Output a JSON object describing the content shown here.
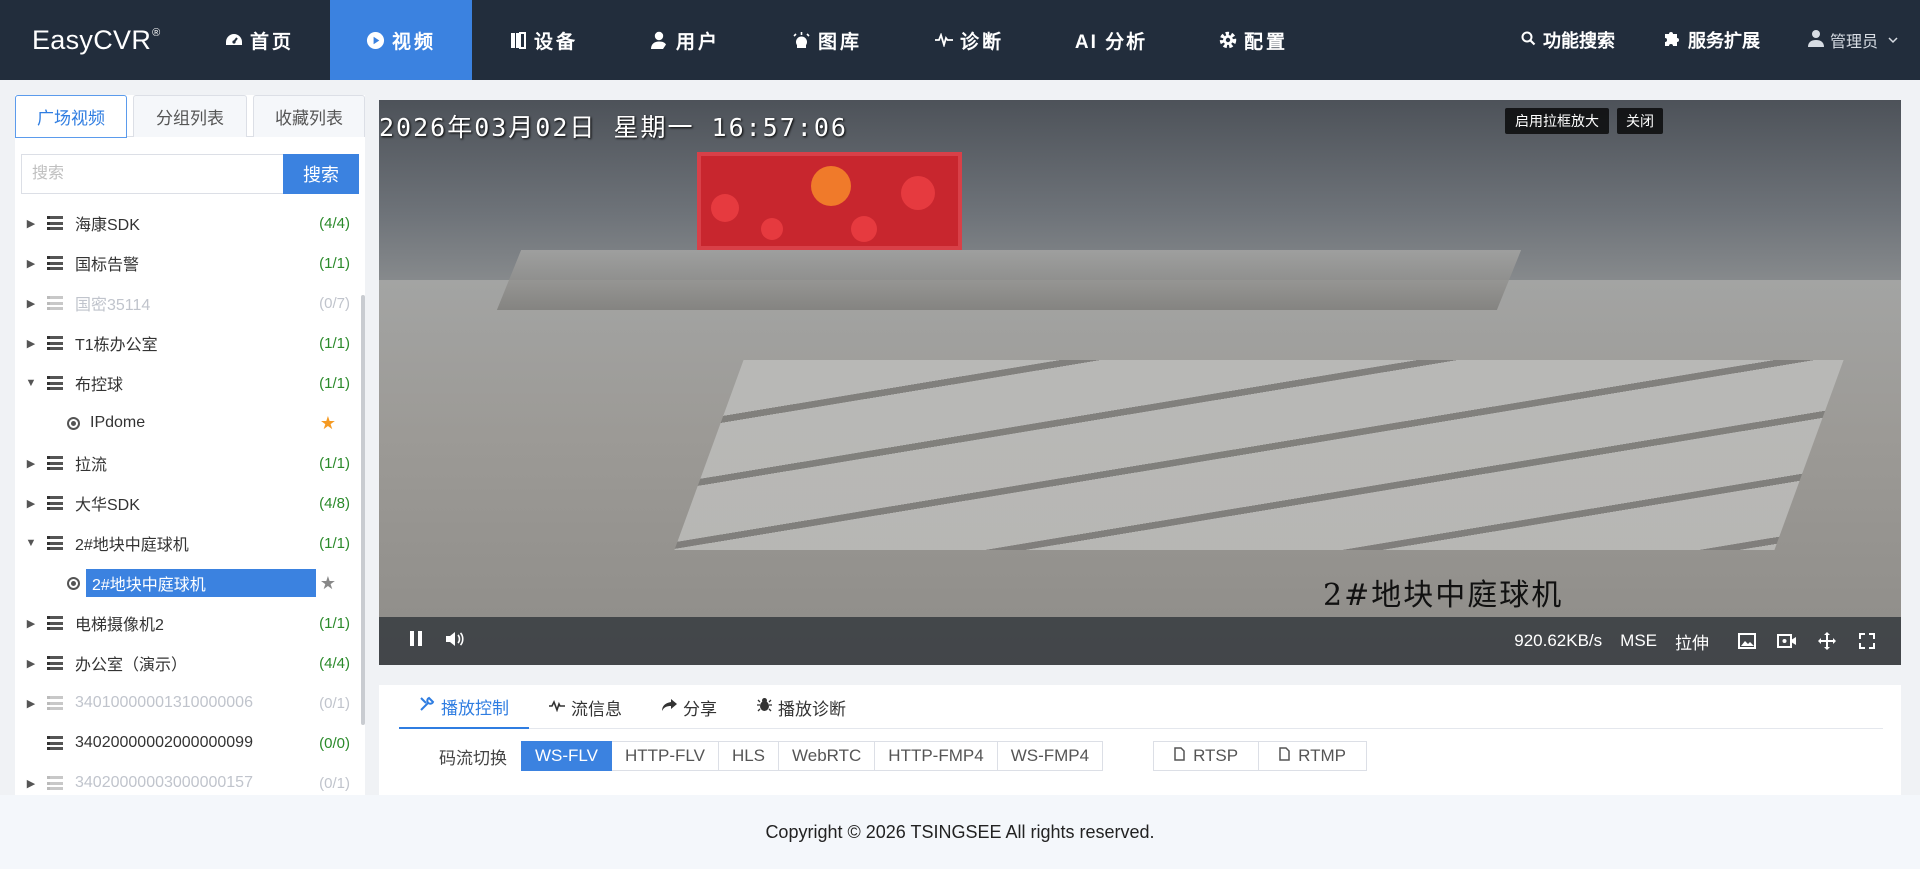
{
  "app": {
    "logo": "EasyCVR",
    "logo_mark": "®"
  },
  "nav": {
    "items": [
      {
        "label": "首页",
        "icon": "dashboard-icon"
      },
      {
        "label": "视频",
        "icon": "play-circle-icon"
      },
      {
        "label": "设备",
        "icon": "device-icon"
      },
      {
        "label": "用户",
        "icon": "user-icon"
      },
      {
        "label": "图库",
        "icon": "gallery-icon"
      },
      {
        "label": "诊断",
        "icon": "pulse-icon"
      },
      {
        "label": "AI 分析",
        "icon": ""
      },
      {
        "label": "配置",
        "icon": "gear-icon"
      }
    ],
    "active_index": 1,
    "right": {
      "search": "功能搜索",
      "extend": "服务扩展",
      "user": "管理员"
    }
  },
  "sidebar": {
    "tabs": [
      "广场视频",
      "分组列表",
      "收藏列表"
    ],
    "active_tab": 0,
    "search": {
      "placeholder": "搜索",
      "button": "搜索"
    },
    "tree": [
      {
        "label": "海康SDK",
        "count": "(4/4)",
        "expanded": false,
        "online": true
      },
      {
        "label": "国标告警",
        "count": "(1/1)",
        "expanded": false,
        "online": true
      },
      {
        "label": "国密35114",
        "count": "(0/7)",
        "expanded": false,
        "online": false
      },
      {
        "label": "T1栋办公室",
        "count": "(1/1)",
        "expanded": false,
        "online": true
      },
      {
        "label": "布控球",
        "count": "(1/1)",
        "expanded": true,
        "online": true
      },
      {
        "label": "IPdome",
        "child": true,
        "favorite": true
      },
      {
        "label": "拉流",
        "count": "(1/1)",
        "expanded": false,
        "online": true
      },
      {
        "label": "大华SDK",
        "count": "(4/8)",
        "expanded": false,
        "online": true
      },
      {
        "label": "2#地块中庭球机",
        "count": "(1/1)",
        "expanded": true,
        "online": true
      },
      {
        "label": "2#地块中庭球机",
        "child": true,
        "selected": true,
        "favorite": false
      },
      {
        "label": "电梯摄像机2",
        "count": "(1/1)",
        "expanded": false,
        "online": true
      },
      {
        "label": "办公室（演示）",
        "count": "(4/4)",
        "expanded": false,
        "online": true
      },
      {
        "label": "34010000001310000006",
        "count": "(0/1)",
        "expanded": false,
        "online": false
      },
      {
        "label": "34020000002000000099",
        "count": "(0/0)",
        "expanded": false,
        "online": true,
        "leaf": true
      },
      {
        "label": "34020000003000000157",
        "count": "(0/1)",
        "expanded": false,
        "online": false
      }
    ]
  },
  "video": {
    "osd_time": "2026年03月02日  星期一  16:57:06",
    "osd_name": "2#地块中庭球机",
    "zoom_button": "启用拉框放大",
    "close_button": "关闭",
    "bitrate": "920.62KB/s",
    "mode": "MSE",
    "stretch": "拉伸"
  },
  "panel": {
    "tabs": [
      {
        "label": "播放控制",
        "icon": "tools-icon"
      },
      {
        "label": "流信息",
        "icon": "pulse-icon"
      },
      {
        "label": "分享",
        "icon": "share-icon"
      },
      {
        "label": "播放诊断",
        "icon": "bug-icon"
      }
    ],
    "active_tab": 0,
    "stream_label": "码流切换",
    "streams": [
      "WS-FLV",
      "HTTP-FLV",
      "HLS",
      "WebRTC",
      "HTTP-FMP4",
      "WS-FMP4"
    ],
    "active_stream": 0,
    "copy_buttons": [
      "RTSP",
      "RTMP"
    ]
  },
  "footer": {
    "text": "Copyright © 2026 TSINGSEE All rights reserved."
  },
  "colors": {
    "nav_bg": "#222d3c",
    "accent": "#3b82e0",
    "online_green": "#2a8a2a",
    "favorite_orange": "#f59a23"
  }
}
